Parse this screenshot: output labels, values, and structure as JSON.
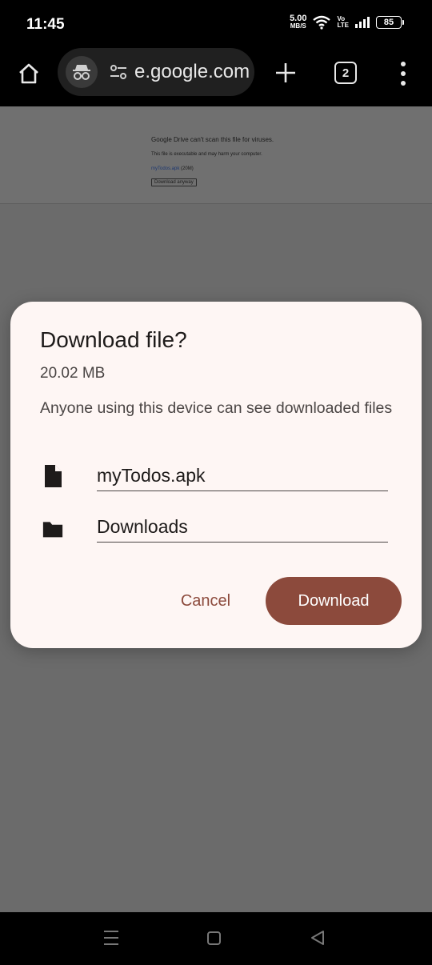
{
  "status_bar": {
    "time": "11:45",
    "net_speed_value": "5.00",
    "net_speed_unit": "MB/S",
    "volte_top": "Vo",
    "volte_bottom": "LTE",
    "battery": "85"
  },
  "toolbar": {
    "url": "e.google.com",
    "tab_count": "2"
  },
  "web_page": {
    "title": "Google Drive can't scan this file for viruses.",
    "warning": "This file is executable and may harm your computer.",
    "file_link": "myTodos.apk",
    "file_size": " (20M)",
    "button": "Download anyway"
  },
  "dialog": {
    "title": "Download file?",
    "size": "20.02 MB",
    "note": "Anyone using this device can see downloaded files",
    "file_name": "myTodos.apk",
    "folder": "Downloads",
    "cancel_label": "Cancel",
    "download_label": "Download"
  },
  "colors": {
    "accent": "#8c4a3c",
    "dialog_bg": "#fef6f4",
    "scrim": "#6b6b6b"
  }
}
